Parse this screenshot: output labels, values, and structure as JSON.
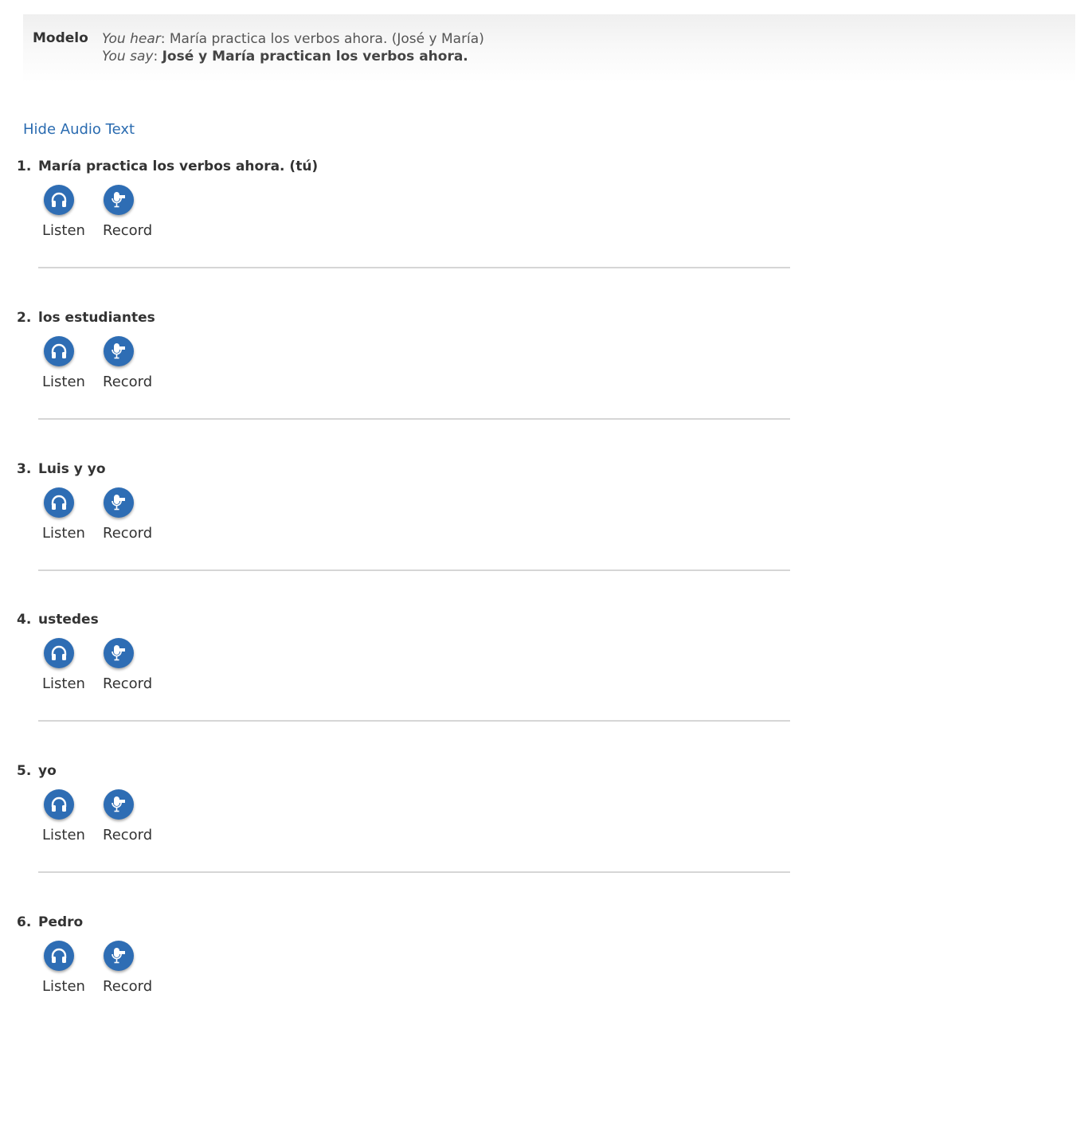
{
  "modelo": {
    "label": "Modelo",
    "hear_prefix": "You hear",
    "hear_text": ": María practica los verbos ahora. (José y María)",
    "say_prefix": "You say",
    "say_colon": ": ",
    "say_answer": "José y María practican los verbos ahora."
  },
  "toggle_link": "Hide Audio Text",
  "controls": {
    "listen_label": "Listen",
    "record_label": "Record",
    "listen_icon": "headphones-icon",
    "record_icon": "microphone-icon"
  },
  "items": [
    {
      "number": "1.",
      "text": "María practica los verbos ahora. (tú)"
    },
    {
      "number": "2.",
      "text": "los estudiantes"
    },
    {
      "number": "3.",
      "text": "Luis y yo"
    },
    {
      "number": "4.",
      "text": "ustedes"
    },
    {
      "number": "5.",
      "text": "yo"
    },
    {
      "number": "6.",
      "text": "Pedro"
    }
  ],
  "colors": {
    "accent": "#2e6db4",
    "link": "#2a6bb0",
    "divider": "#d6d6d6"
  }
}
